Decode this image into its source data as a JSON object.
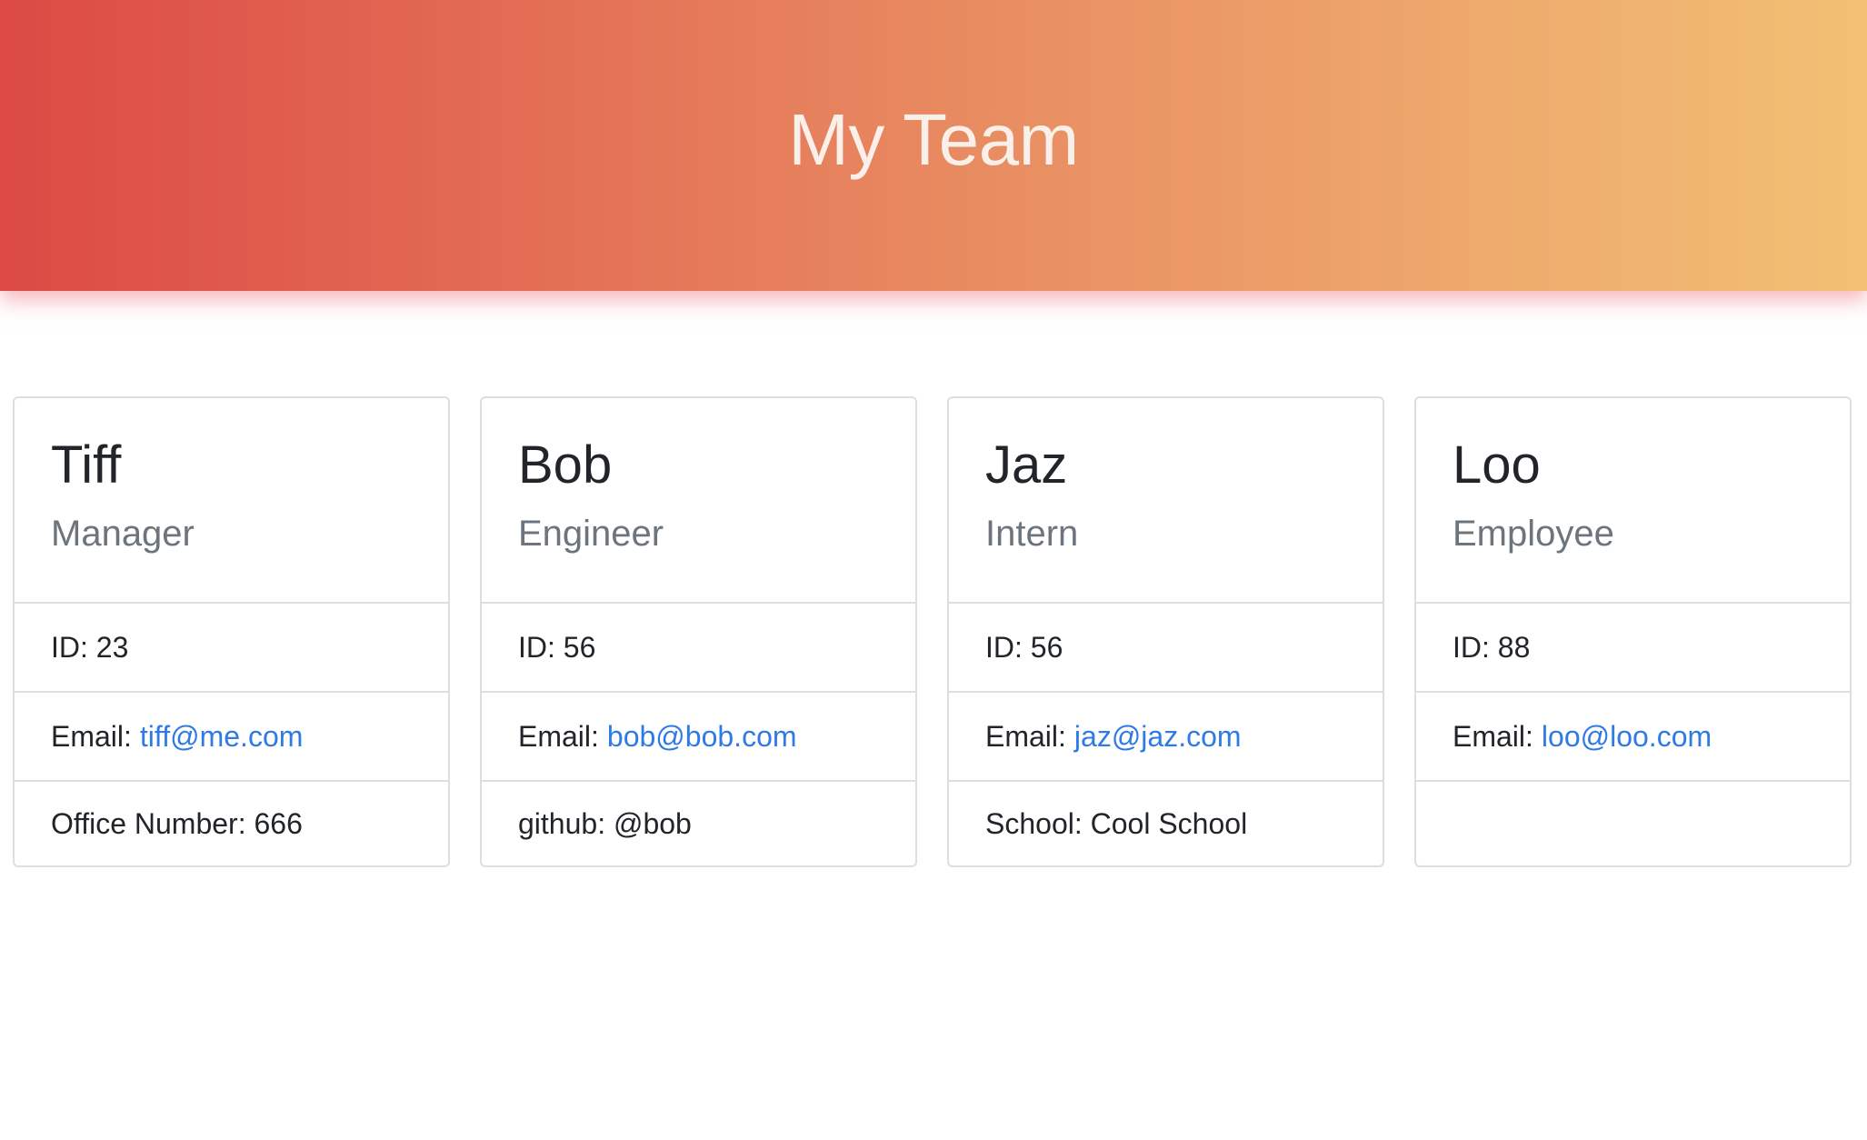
{
  "header": {
    "title": "My Team"
  },
  "colors": {
    "header_gradient_start": "#dc4a45",
    "header_gradient_end": "#f2c074",
    "link": "#2f7ae5",
    "role_text": "#6c757d"
  },
  "cards": [
    {
      "name": "Tiff",
      "role": "Manager",
      "id": "ID: 23",
      "email_label": "Email:",
      "email": "tiff@me.com",
      "extra": "Office Number: 666"
    },
    {
      "name": "Bob",
      "role": "Engineer",
      "id": "ID: 56",
      "email_label": "Email:",
      "email": "bob@bob.com",
      "extra": "github: @bob"
    },
    {
      "name": "Jaz",
      "role": "Intern",
      "id": "ID: 56",
      "email_label": "Email:",
      "email": "jaz@jaz.com",
      "extra": "School: Cool School"
    },
    {
      "name": "Loo",
      "role": "Employee",
      "id": "ID: 88",
      "email_label": "Email:",
      "email": "loo@loo.com",
      "extra": ""
    }
  ]
}
